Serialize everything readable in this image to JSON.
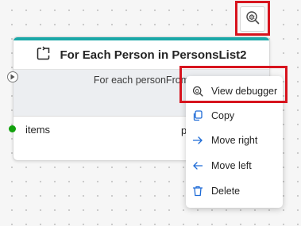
{
  "toolbar": {
    "debugger_icon": "bug-magnifier-icon"
  },
  "node": {
    "title": "For Each Person in PersonsList2",
    "title_icon": "loop-icon",
    "description": "For each personFrom",
    "items_label": "items",
    "right_text": "p",
    "accent_color": "#1aa8a8"
  },
  "context_menu": {
    "items": [
      {
        "label": "View debugger",
        "icon": "bug-magnifier-icon"
      },
      {
        "label": "Copy",
        "icon": "copy-icon"
      },
      {
        "label": "Move right",
        "icon": "arrow-right-icon"
      },
      {
        "label": "Move left",
        "icon": "arrow-left-icon"
      },
      {
        "label": "Delete",
        "icon": "trash-icon"
      }
    ]
  },
  "highlight_color": "#d7141e"
}
